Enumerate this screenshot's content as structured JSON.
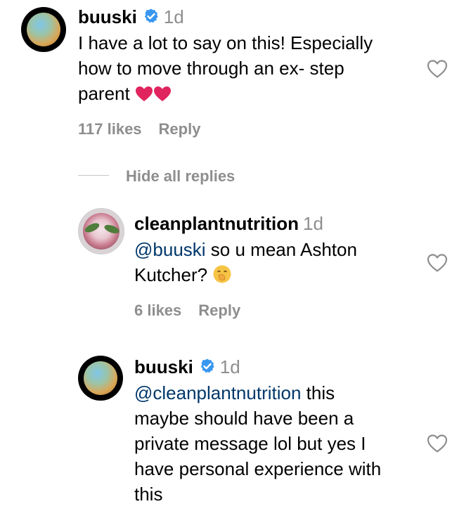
{
  "comments": [
    {
      "username": "buuski",
      "verified": true,
      "time": "1d",
      "lines": [
        "I have a lot to say on this! Especially",
        "how to move through an ex- step",
        "parent"
      ],
      "trailing_emoji": "❤️❤️",
      "likes": "117 likes",
      "reply": "Reply",
      "avatar_icon": "avatar-gradient"
    },
    {
      "username": "cleanplantnutrition",
      "verified": false,
      "time": "1d",
      "mention": "@buuski",
      "text_line1": "so u mean Ashton",
      "text_line2": "Kutcher?",
      "trailing_emoji": "🤭",
      "likes": "6 likes",
      "reply": "Reply",
      "avatar_icon": "avatar-food"
    },
    {
      "username": "buuski",
      "verified": true,
      "time": "1d",
      "mention": "@cleanplantnutrition",
      "text_line1": "this",
      "lines": [
        "maybe should have been a",
        "private message lol but yes I",
        "have personal experience with",
        "this"
      ],
      "avatar_icon": "avatar-gradient"
    }
  ],
  "replies_toggle": "Hide all replies",
  "colors": {
    "text": "#000000",
    "muted": "#8e8e8e",
    "mention": "#00376b",
    "verified": "#3897f0",
    "heart_red": "#e0245e"
  }
}
